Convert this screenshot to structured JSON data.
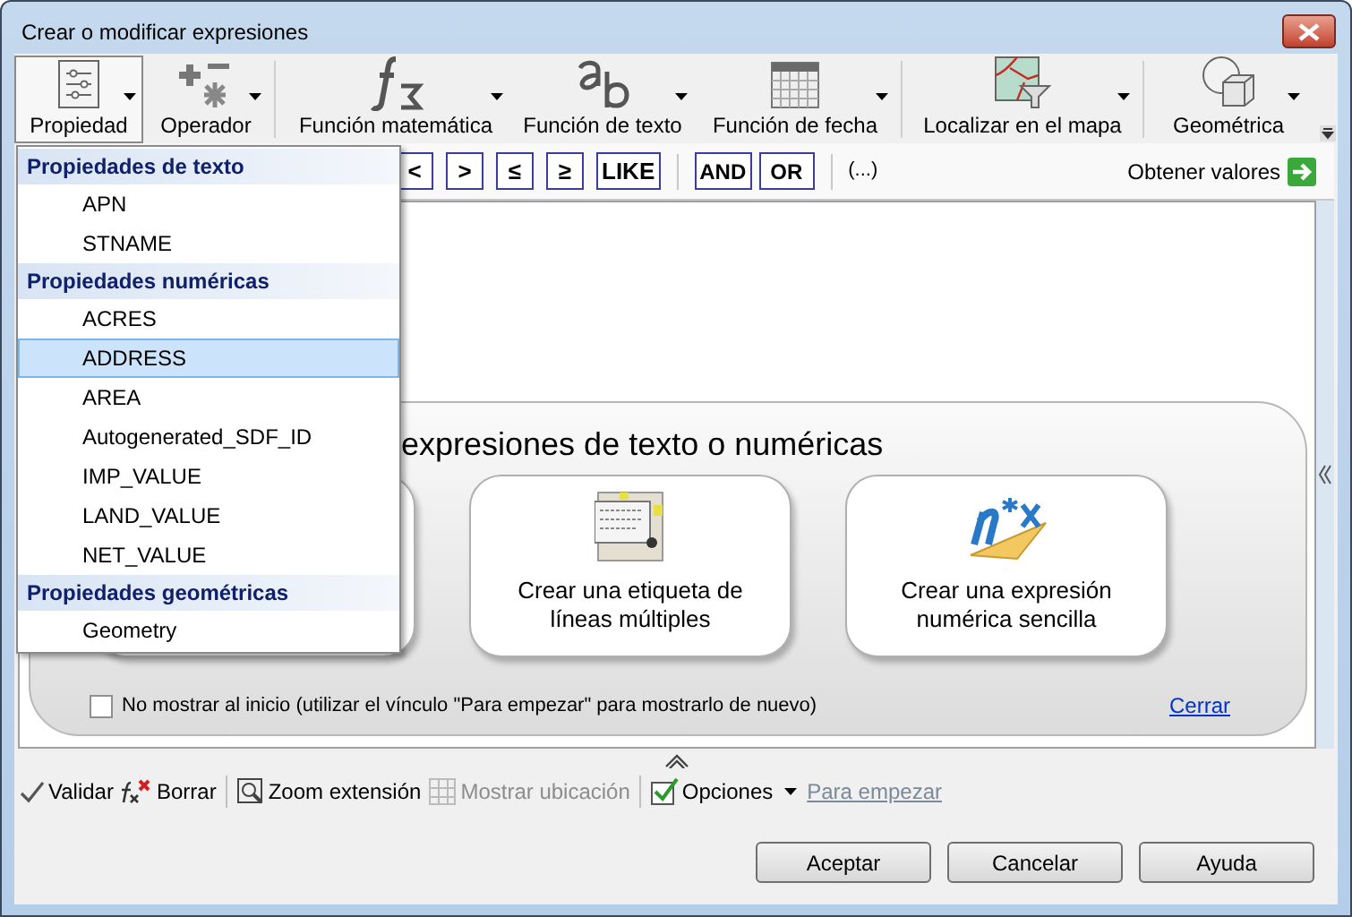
{
  "window": {
    "title": "Crear o modificar expresiones"
  },
  "ribbon": [
    {
      "label": "Propiedad",
      "kind": "property",
      "selected": true
    },
    {
      "label": "Operador",
      "kind": "operator",
      "selected": false
    },
    {
      "label": "Función matemática",
      "kind": "math",
      "selected": false
    },
    {
      "label": "Función de texto",
      "kind": "text",
      "selected": false
    },
    {
      "label": "Función de fecha",
      "kind": "date",
      "selected": false
    },
    {
      "label": "Localizar en el mapa",
      "kind": "map",
      "selected": false
    },
    {
      "label": "Geométrica",
      "kind": "geometry",
      "selected": false
    }
  ],
  "operators": [
    "<",
    ">",
    "≤",
    "≥",
    "LIKE"
  ],
  "logic_operators": [
    "AND",
    "OR"
  ],
  "parentheses": "(...)",
  "get_values": "Obtener valores",
  "property_menu": [
    {
      "header": "Propiedades de texto",
      "items": [
        {
          "label": "APN",
          "selected": false
        },
        {
          "label": "STNAME",
          "selected": false
        }
      ]
    },
    {
      "header": "Propiedades numéricas",
      "items": [
        {
          "label": "ACRES",
          "selected": false
        },
        {
          "label": "ADDRESS",
          "selected": true
        },
        {
          "label": "AREA",
          "selected": false
        },
        {
          "label": "Autogenerated_SDF_ID",
          "selected": false
        },
        {
          "label": "IMP_VALUE",
          "selected": false
        },
        {
          "label": "LAND_VALUE",
          "selected": false
        },
        {
          "label": "NET_VALUE",
          "selected": false
        }
      ]
    },
    {
      "header": "Propiedades geométricas",
      "items": [
        {
          "label": "Geometry",
          "selected": false
        }
      ]
    }
  ],
  "start_panel": {
    "heading": "expresiones de texto o numéricas",
    "cards": [
      {
        "label": "Crear una etiqueta de líneas múltiples",
        "kind": "label"
      },
      {
        "label": "Crear una expresión numérica sencilla",
        "kind": "numeric"
      }
    ],
    "dont_show": {
      "label": "No mostrar al inicio (utilizar el vínculo \"Para empezar\" para mostrarlo de nuevo)",
      "checked": false
    },
    "close_link": "Cerrar"
  },
  "bottom_toolbar": [
    {
      "label": "Validar",
      "kind": "validate",
      "disabled": false
    },
    {
      "label": "Borrar",
      "kind": "clear",
      "disabled": false
    },
    {
      "kind": "separator"
    },
    {
      "label": "Zoom extensión",
      "kind": "zoom",
      "disabled": false
    },
    {
      "label": "Mostrar ubicación",
      "kind": "locate",
      "disabled": true
    },
    {
      "kind": "separator"
    },
    {
      "label": "Opciones",
      "kind": "options",
      "disabled": false
    },
    {
      "label": "Para empezar",
      "kind": "link"
    }
  ],
  "dialog_buttons": [
    "Aceptar",
    "Cancelar",
    "Ayuda"
  ]
}
